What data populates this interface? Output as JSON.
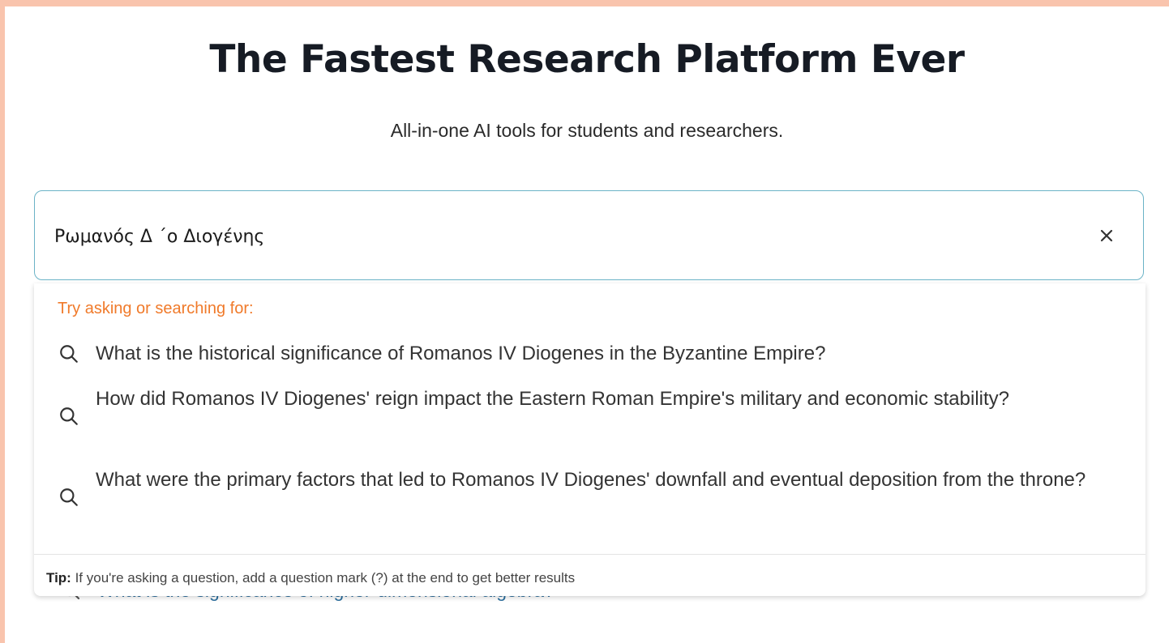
{
  "hero": {
    "title": "The Fastest Research Platform Ever",
    "subtitle": "All-in-one AI tools for students and researchers."
  },
  "search": {
    "value": "Ρωμανός Δ ΄ο Διογένης",
    "clear_icon": "close-icon"
  },
  "dropdown": {
    "header": "Try asking or searching for:",
    "suggestions": [
      {
        "icon": "search-icon",
        "text": "What is the historical significance of Romanos IV Diogenes in the Byzantine Empire?"
      },
      {
        "icon": "search-icon",
        "text": "How did Romanos IV Diogenes' reign impact the Eastern Roman Empire's military and economic stability?"
      },
      {
        "icon": "search-icon",
        "text": "What were the primary factors that led to Romanos IV Diogenes' downfall and eventual deposition from the throne?"
      }
    ],
    "tip_label": "Tip:",
    "tip_text": " If you're asking a question, add a question mark (?) at the end to get better results"
  },
  "background_suggestion": {
    "text": "What is the significance of higher-dimensional algebra?"
  },
  "colors": {
    "page_border": "#f9c4ad",
    "accent_orange": "#f07a2a",
    "input_border": "#6bb3c7",
    "link_blue": "#2c6f9e"
  }
}
